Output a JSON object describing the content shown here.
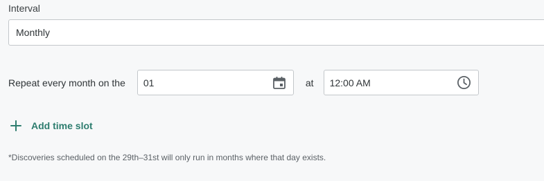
{
  "interval": {
    "label": "Interval",
    "selected": "Monthly"
  },
  "repeat": {
    "prefix": "Repeat every month on the",
    "day_value": "01",
    "at_label": "at",
    "time_value": "12:00 AM"
  },
  "add_time_slot": {
    "label": "Add time slot"
  },
  "footnote": "*Discoveries scheduled on the 29th–31st will only run in months where that day exists.",
  "colors": {
    "accent": "#2e7d6f",
    "icon": "#5b6166",
    "border": "#c3c7ca"
  },
  "icons": {
    "day_picker": "calendar-icon",
    "time_picker": "clock-icon",
    "add": "plus-icon"
  }
}
